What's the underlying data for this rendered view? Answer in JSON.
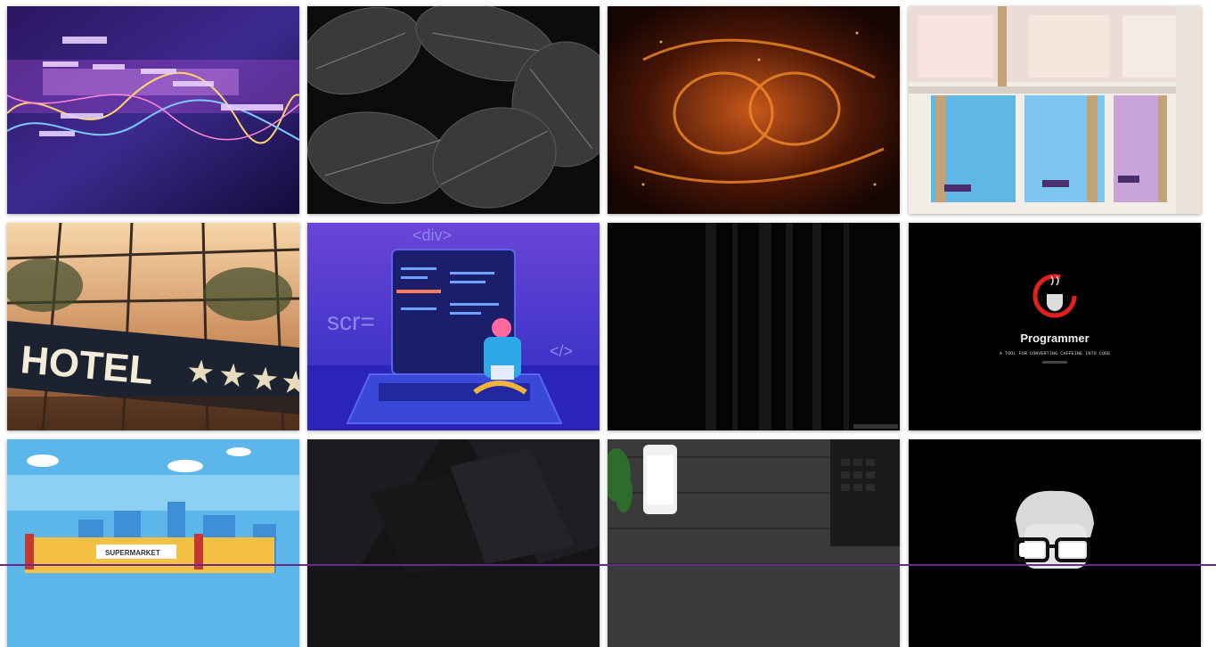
{
  "gallery": {
    "items": [
      {
        "id": "neon-data-waves",
        "alt": "Neon data waves"
      },
      {
        "id": "monstera-leaves",
        "alt": "Monstera leaves in black and white"
      },
      {
        "id": "fiery-nebula",
        "alt": "Fiery orange nebula"
      },
      {
        "id": "capsule-hostel",
        "alt": "Capsule hostel beds"
      },
      {
        "id": "hotel-sign",
        "alt": "Hotel sign with stars",
        "sign_text": "HOTEL"
      },
      {
        "id": "developer-laptop",
        "alt": "Developer with laptop illustration",
        "code_tag": "<div>",
        "scr_text": "scr=",
        "close_tag": "</>"
      },
      {
        "id": "dark-wood",
        "alt": "Dark wood texture"
      },
      {
        "id": "programmer-caffeine",
        "alt": "Programmer caffeine wallpaper",
        "title": "Programmer",
        "subtitle": "A TOOL FOR CONVERTING CAFFEINE INTO CODE"
      },
      {
        "id": "supermarket",
        "alt": "Supermarket illustration",
        "store_sign": "SUPERMARKET"
      },
      {
        "id": "dark-geometric",
        "alt": "Dark geometric background"
      },
      {
        "id": "desk-phone-keyboard",
        "alt": "Desk with phone and keyboard"
      },
      {
        "id": "nerd-avatar",
        "alt": "Nerd glasses avatar"
      }
    ]
  },
  "colors": {
    "accent_bar": "#6b2a8a"
  }
}
